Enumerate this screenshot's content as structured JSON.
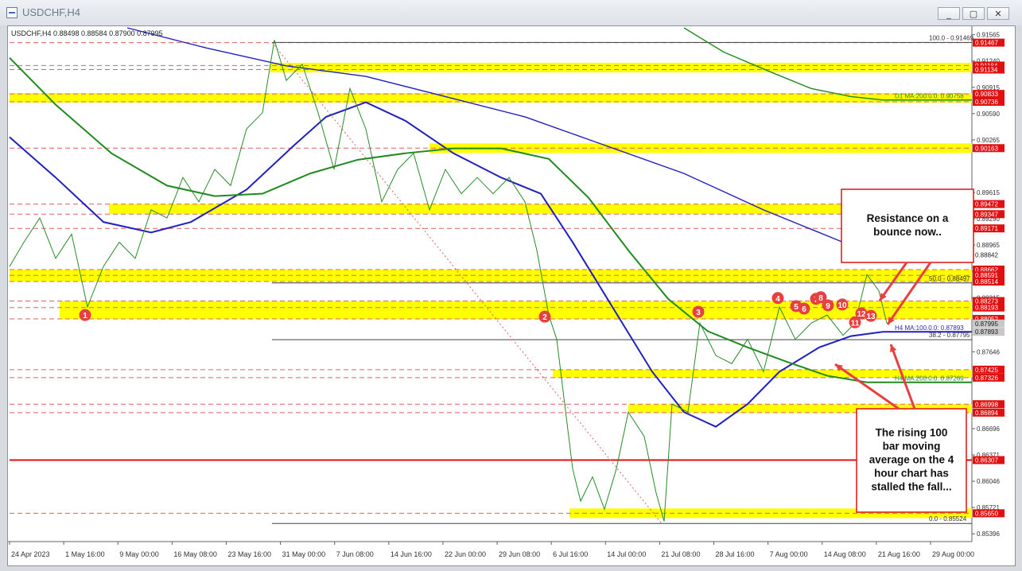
{
  "window": {
    "title": "USDCHF,H4",
    "buttons": {
      "minimize": "_",
      "maximize": "▢",
      "close": "✕"
    }
  },
  "chart_data": {
    "type": "line",
    "symbol": "USDCHF,H4",
    "ohlc_header": "USDCHF,H4  0.88498 0.88584 0.87900 0.87995",
    "ylim": [
      0.853,
      0.9165
    ],
    "price_axis_ticks": [
      "0.91565",
      "0.91240",
      "0.90915",
      "0.90590",
      "0.90265",
      "0.89615",
      "0.89290",
      "0.88965",
      "0.88640",
      "0.88315",
      "0.87646",
      "0.87321",
      "0.86696",
      "0.86371",
      "0.86046",
      "0.85721",
      "0.85396"
    ],
    "time_axis_labels": [
      "24 Apr 2023",
      "1 May 16:00",
      "9 May 00:00",
      "16 May 08:00",
      "23 May 16:00",
      "31 May 00:00",
      "7 Jun 08:00",
      "14 Jun 16:00",
      "22 Jun 00:00",
      "29 Jun 08:00",
      "6 Jul 16:00",
      "14 Jul 00:00",
      "21 Jul 08:00",
      "28 Jul 16:00",
      "7 Aug 00:00",
      "14 Aug 08:00",
      "21 Aug 16:00",
      "29 Aug 00:00"
    ],
    "support_resistance_zones": [
      {
        "low": 0.91134,
        "high": 0.91184
      },
      {
        "low": 0.90736,
        "high": 0.90833
      },
      {
        "low": 0.90163,
        "high": 0.90163
      },
      {
        "low": 0.89347,
        "high": 0.89472
      },
      {
        "low": 0.88514,
        "high": 0.88662
      },
      {
        "low": 0.88052,
        "high": 0.88273
      },
      {
        "low": 0.87326,
        "high": 0.87425
      },
      {
        "low": 0.86894,
        "high": 0.86998
      },
      {
        "low": 0.8565,
        "high": 0.8565
      }
    ],
    "price_labels_red": [
      "0.91467",
      "0.91184",
      "0.91134",
      "0.90833",
      "0.90736",
      "0.90163",
      "0.89472",
      "0.89347",
      "0.89171",
      "0.88662",
      "0.88591",
      "0.88514",
      "0.88273",
      "0.88193",
      "0.88052",
      "0.87425",
      "0.87326",
      "0.86998",
      "0.86894",
      "0.86307",
      "0.85650"
    ],
    "price_labels_gray": [
      "0.87995",
      "0.87893"
    ],
    "price_labels_white": [
      "0.88842"
    ],
    "fibonacci": [
      {
        "label": "100.0 - 0.91469",
        "price": 0.91469
      },
      {
        "label": "50.0 - 0.88497",
        "price": 0.88497
      },
      {
        "label": "38.2 - 0.87795",
        "price": 0.87795
      },
      {
        "label": "0.0 - 0.85524",
        "price": 0.85524
      }
    ],
    "horizontal_line": {
      "price": 0.86307,
      "color": "#e01010"
    },
    "moving_average_labels": [
      {
        "text": "D1 MA:200.0.0: 0.90758",
        "color": "#2a8a2a",
        "price": 0.90758
      },
      {
        "text": "D1 MA:100.0.0: 0.88842",
        "color": "#2a2aa8",
        "price": 0.88842
      },
      {
        "text": "H4 MA:100.0.0: 0.87893",
        "color": "#2a2aa8",
        "price": 0.87893
      },
      {
        "text": "H4 MA:200.0.0: 0.87269",
        "color": "#2a8a2a",
        "price": 0.87269
      }
    ],
    "swing_markers": [
      "1",
      "2",
      "3",
      "4",
      "5",
      "6",
      "7",
      "8",
      "9",
      "10",
      "11",
      "12",
      "13"
    ],
    "annotations": [
      {
        "text": "Resistance on a bounce now..",
        "lines": [
          "Resistance on a",
          "bounce now.."
        ]
      },
      {
        "text": "The rising 100 bar moving average on the 4 hour chart has stalled the fall...",
        "lines": [
          "The rising 100",
          "bar moving",
          "average on the 4",
          "hour chart has",
          "stalled the fall..."
        ]
      }
    ],
    "colors": {
      "candle": "#2a8a2a",
      "zone": "#ffff00",
      "red_level": "#e01010",
      "ma_blue": "#2020c0",
      "ma_green": "#1f8a1f",
      "marker": "#e84040"
    },
    "grid": false
  }
}
